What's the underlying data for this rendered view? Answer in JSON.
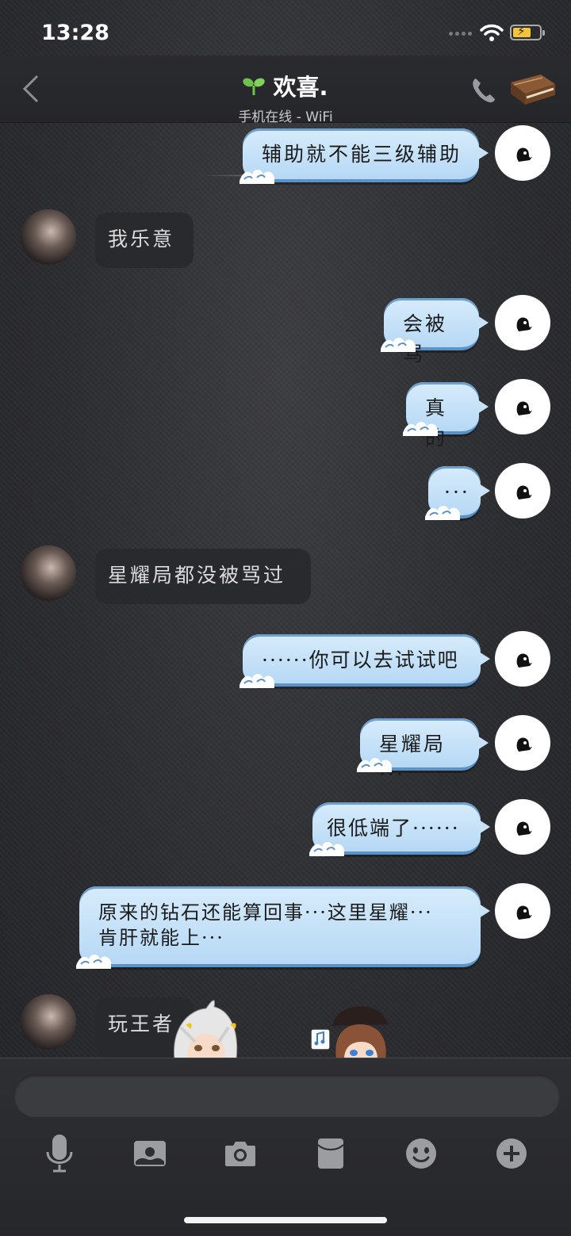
{
  "status_bar": {
    "time": "13:28"
  },
  "header": {
    "title": "欢喜.",
    "subtitle": "手机在线 - WiFi"
  },
  "messages": [
    {
      "side": "out",
      "text": "辅助就不能三级辅助"
    },
    {
      "side": "in",
      "text": "我乐意"
    },
    {
      "side": "out",
      "text": "会被骂"
    },
    {
      "side": "out",
      "text": "真的"
    },
    {
      "side": "out",
      "text": "···"
    },
    {
      "side": "in",
      "text": "星耀局都没被骂过"
    },
    {
      "side": "out",
      "text": "······你可以去试试吧"
    },
    {
      "side": "out",
      "text": "星耀局···"
    },
    {
      "side": "out",
      "text": "很低端了······"
    },
    {
      "side": "out",
      "line1": "原来的钻石还能算回事···这里星耀···",
      "line2": "肯肝就能上···"
    },
    {
      "side": "in",
      "text": "玩王者"
    }
  ],
  "input": {
    "placeholder": ""
  },
  "toolbar": {
    "icons": [
      "microphone-icon",
      "image-icon",
      "camera-icon",
      "red-packet-icon",
      "emoji-icon",
      "plus-icon"
    ]
  },
  "colors": {
    "bubble_out": "#c8e2f8",
    "bubble_in": "#28292d",
    "online_sprout": "#6cc24a",
    "battery": "#f3c43a"
  }
}
